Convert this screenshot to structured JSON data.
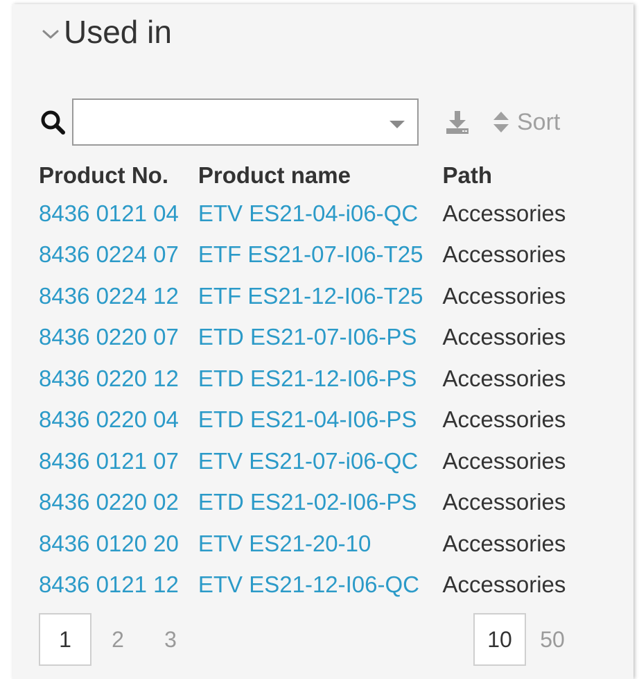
{
  "section": {
    "title": "Used in"
  },
  "search": {
    "value": "",
    "placeholder": ""
  },
  "toolbar": {
    "sort_label": "Sort"
  },
  "table": {
    "columns": [
      "Product No.",
      "Product name",
      "Path"
    ],
    "rows": [
      {
        "product_no": "8436 0121 04",
        "product_name": "ETV ES21-04-i06-QC",
        "path": "Accessories"
      },
      {
        "product_no": "8436 0224 07",
        "product_name": "ETF ES21-07-I06-T25",
        "path": "Accessories"
      },
      {
        "product_no": "8436 0224 12",
        "product_name": "ETF ES21-12-I06-T25",
        "path": "Accessories"
      },
      {
        "product_no": "8436 0220 07",
        "product_name": "ETD ES21-07-I06-PS",
        "path": "Accessories"
      },
      {
        "product_no": "8436 0220 12",
        "product_name": "ETD ES21-12-I06-PS",
        "path": "Accessories"
      },
      {
        "product_no": "8436 0220 04",
        "product_name": "ETD ES21-04-I06-PS",
        "path": "Accessories"
      },
      {
        "product_no": "8436 0121 07",
        "product_name": "ETV ES21-07-i06-QC",
        "path": "Accessories"
      },
      {
        "product_no": "8436 0220 02",
        "product_name": "ETD ES21-02-I06-PS",
        "path": "Accessories"
      },
      {
        "product_no": "8436 0120 20",
        "product_name": "ETV ES21-20-10",
        "path": "Accessories"
      },
      {
        "product_no": "8436 0121 12",
        "product_name": "ETV ES21-12-I06-QC",
        "path": "Accessories"
      }
    ]
  },
  "pagination": {
    "pages": [
      "1",
      "2",
      "3"
    ],
    "current_page": "1",
    "page_sizes": [
      "10",
      "50"
    ],
    "current_page_size": "10"
  },
  "colors": {
    "link": "#2b9ac8",
    "text": "#333333",
    "muted": "#a0a0a0",
    "panel_bg": "#f5f5f5"
  },
  "icons": {
    "collapse": "chevron-down-icon",
    "search": "search-icon",
    "dropdown": "caret-down-icon",
    "export": "download-icon",
    "sort": "sort-arrows-icon"
  }
}
